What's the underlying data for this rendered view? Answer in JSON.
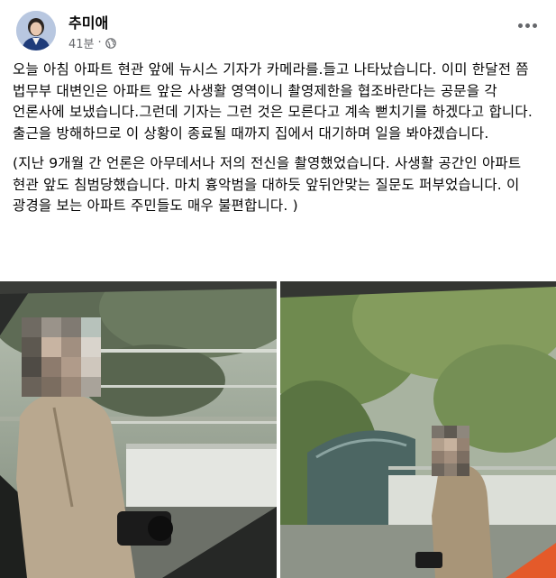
{
  "post": {
    "author": "추미애",
    "time": "41분",
    "separator": "·",
    "privacy_icon": "globe-icon",
    "more_icon": "more-options-icon",
    "paragraphs": [
      "오늘 아침 아파트 현관 앞에 뉴시스 기자가 카메라를.들고 나타났습니다. 이미 한달전 쯤 법무부 대변인은 아파트 앞은 사생활 영역이니 촬영제한을 협조바란다는 공문을 각 언론사에 보냈습니다.그런데  기자는 그런 것은 모른다고 계속 뻗치기를 하겠다고 합니다. 출근을 방해하므로 이 상황이 종료될 때까지 집에서 대기하며 일을 봐야겠습니다.",
      "(지난 9개월 간 언론은 아무데서나 저의 전신을 촬영했었습니다. 사생활 공간인 아파트 현관 앞도 침범당했습니다. 마치 흉악범을 대하듯 앞뒤안맞는 질문도 퍼부었습니다. 이 광경을 보는 아파트 주민들도 매우 불편합니다. )"
    ]
  },
  "colors": {
    "text": "#050505",
    "secondary": "#65676b",
    "background": "#ffffff"
  }
}
